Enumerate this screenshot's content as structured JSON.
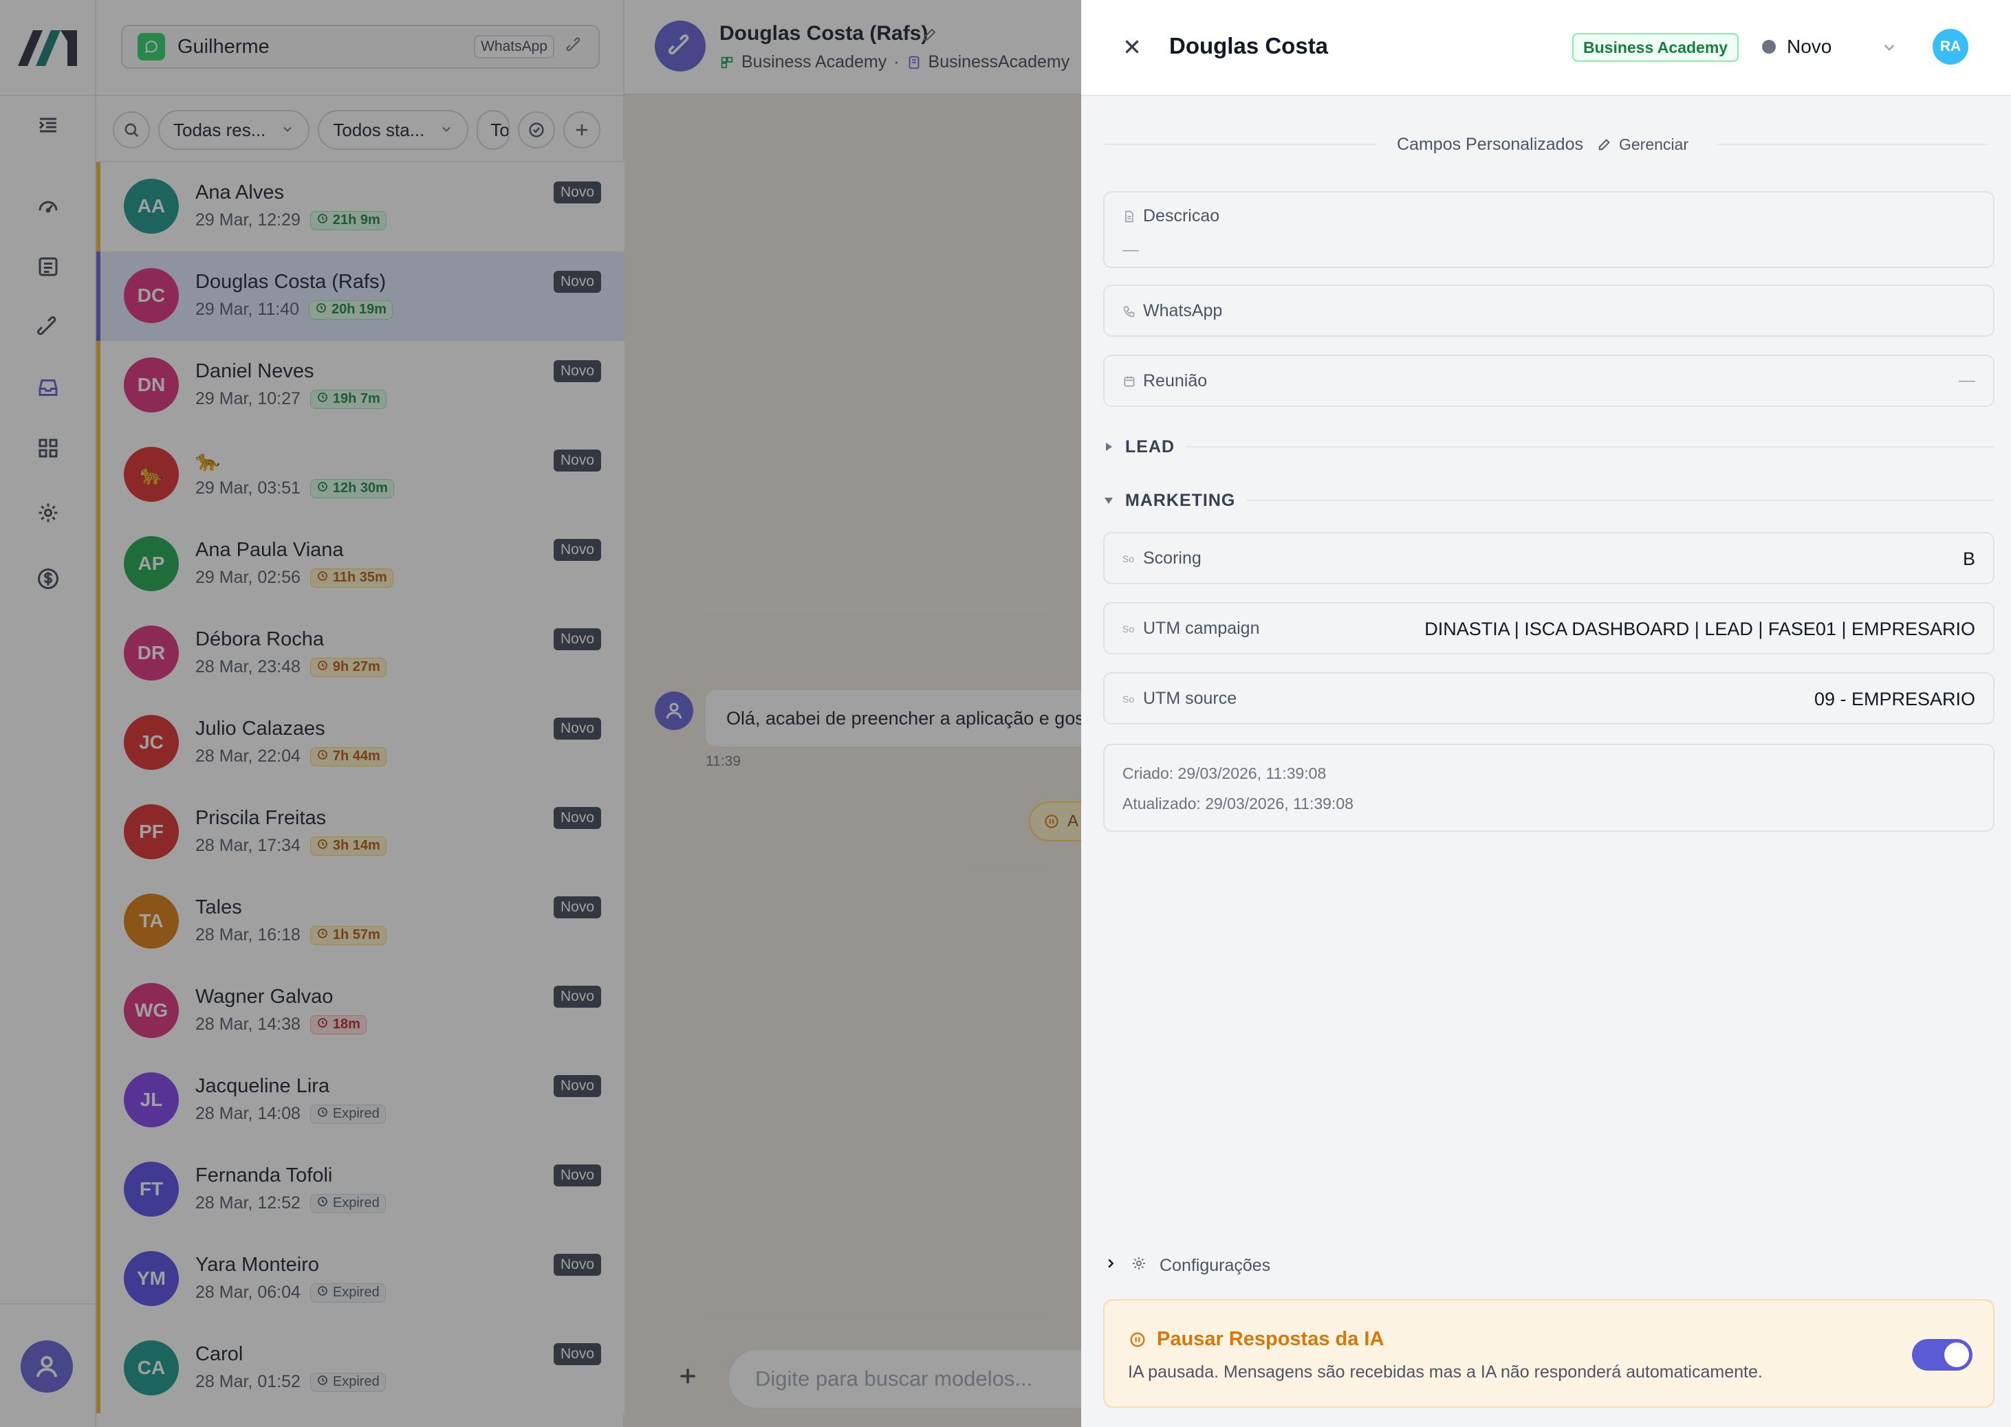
{
  "inbox": {
    "name": "Guilherme",
    "channel_tag": "WhatsApp"
  },
  "filters": {
    "responsible": "Todas res...",
    "status": "Todos sta...",
    "third": "To"
  },
  "conversations": [
    {
      "initials": "AA",
      "name": "Ana Alves",
      "date": "29 Mar, 12:29",
      "timer": "21h 9m",
      "timer_level": "green",
      "status": "Novo",
      "avatar_color": "#0f9488"
    },
    {
      "initials": "DC",
      "name": "Douglas Costa (Rafs)",
      "date": "29 Mar, 11:40",
      "timer": "20h 19m",
      "timer_level": "green",
      "status": "Novo",
      "avatar_color": "#db2777"
    },
    {
      "initials": "DN",
      "name": "Daniel Neves",
      "date": "29 Mar, 10:27",
      "timer": "19h 7m",
      "timer_level": "green",
      "status": "Novo",
      "avatar_color": "#db2777"
    },
    {
      "initials": "🐆",
      "name": "🐆",
      "date": "29 Mar, 03:51",
      "timer": "12h 30m",
      "timer_level": "green",
      "status": "Novo",
      "avatar_color": "#dc2626"
    },
    {
      "initials": "AP",
      "name": "Ana Paula Viana",
      "date": "29 Mar, 02:56",
      "timer": "11h 35m",
      "timer_level": "amber",
      "status": "Novo",
      "avatar_color": "#16a34a"
    },
    {
      "initials": "DR",
      "name": "Débora Rocha",
      "date": "28 Mar, 23:48",
      "timer": "9h 27m",
      "timer_level": "amber",
      "status": "Novo",
      "avatar_color": "#db2777"
    },
    {
      "initials": "JC",
      "name": "Julio Calazaes",
      "date": "28 Mar, 22:04",
      "timer": "7h 44m",
      "timer_level": "amber",
      "status": "Novo",
      "avatar_color": "#dc2626"
    },
    {
      "initials": "PF",
      "name": "Priscila Freitas",
      "date": "28 Mar, 17:34",
      "timer": "3h 14m",
      "timer_level": "amber",
      "status": "Novo",
      "avatar_color": "#dc2626"
    },
    {
      "initials": "TA",
      "name": "Tales",
      "date": "28 Mar, 16:18",
      "timer": "1h 57m",
      "timer_level": "amber",
      "status": "Novo",
      "avatar_color": "#d97706"
    },
    {
      "initials": "WG",
      "name": "Wagner Galvao",
      "date": "28 Mar, 14:38",
      "timer": "18m",
      "timer_level": "red",
      "status": "Novo",
      "avatar_color": "#db2777"
    },
    {
      "initials": "JL",
      "name": "Jacqueline Lira",
      "date": "28 Mar, 14:08",
      "timer": "Expired",
      "timer_level": "gray",
      "status": "Novo",
      "avatar_color": "#7c3aed"
    },
    {
      "initials": "FT",
      "name": "Fernanda Tofoli",
      "date": "28 Mar, 12:52",
      "timer": "Expired",
      "timer_level": "gray",
      "status": "Novo",
      "avatar_color": "#4f46e5"
    },
    {
      "initials": "YM",
      "name": "Yara Monteiro",
      "date": "28 Mar, 06:04",
      "timer": "Expired",
      "timer_level": "gray",
      "status": "Novo",
      "avatar_color": "#4f46e5"
    },
    {
      "initials": "CA",
      "name": "Carol",
      "date": "28 Mar, 01:52",
      "timer": "Expired",
      "timer_level": "gray",
      "status": "Novo",
      "avatar_color": "#0f9488"
    }
  ],
  "chat": {
    "title": "Douglas Costa (Rafs)",
    "board": "Business Academy",
    "inbox_ref": "BusinessAcademy",
    "message_text": "Olá, acabei de preencher a aplicação e gos",
    "message_time": "11:39",
    "system_pill": "A",
    "composer_placeholder": "Digite para buscar modelos..."
  },
  "panel": {
    "title": "Douglas Costa",
    "inbox_badge": "Business Academy",
    "stage": "Novo",
    "user_initials": "RA",
    "section_title": "Campos Personalizados",
    "manage_label": "Gerenciar",
    "fields_top": {
      "descricao_label": "Descricao",
      "descricao_value": "—",
      "whatsapp_label": "WhatsApp",
      "reuniao_label": "Reunião",
      "reuniao_value": "—"
    },
    "group_lead": "LEAD",
    "group_marketing": "MARKETING",
    "so_tag": "So",
    "marketing_fields": [
      {
        "label": "Scoring",
        "value": "B"
      },
      {
        "label": "UTM campaign",
        "value": "DINASTIA | ISCA DASHBOARD | LEAD | FASE01 | EMPRESARIO"
      },
      {
        "label": "UTM source",
        "value": "09 - EMPRESARIO"
      }
    ],
    "created": "Criado: 29/03/2026, 11:39:08",
    "updated": "Atualizado: 29/03/2026, 11:39:08",
    "config_label": "Configurações",
    "ai_title": "Pausar Respostas da IA",
    "ai_desc": "IA pausada. Mensagens são recebidas mas a IA não responderá automaticamente.",
    "ai_toggle_on": true
  },
  "colors": {
    "accent": "#5b5bd6",
    "row_border_pending": "#f0b429"
  }
}
